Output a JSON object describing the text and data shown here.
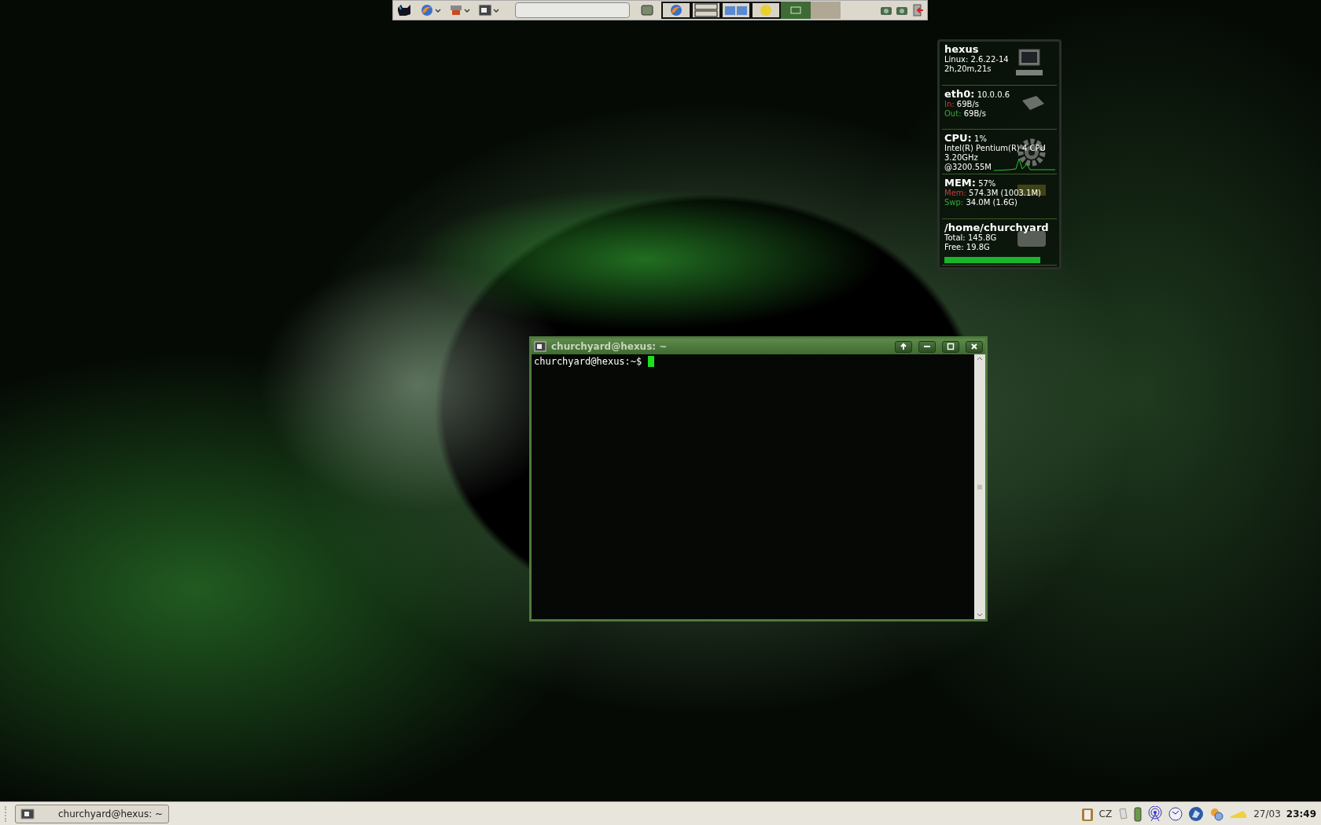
{
  "top_panel": {
    "launchers": [
      {
        "kind": "menu",
        "dropdown": false
      },
      {
        "kind": "browser",
        "dropdown": true
      },
      {
        "kind": "tools",
        "dropdown": true
      },
      {
        "kind": "terminal",
        "dropdown": true
      }
    ],
    "workspaces": [
      {
        "kind": "browser",
        "selected": false
      },
      {
        "kind": "windows",
        "selected": false
      },
      {
        "kind": "folders",
        "selected": false
      },
      {
        "kind": "smiley",
        "selected": false
      },
      {
        "kind": "window",
        "selected": true
      },
      {
        "kind": "empty",
        "selected": false
      }
    ]
  },
  "conky": {
    "sections": [
      {
        "kind": "host",
        "title": "hexus",
        "lines": [
          "Linux: 2.6.22-14",
          "2h,20m,21s"
        ]
      },
      {
        "kind": "net",
        "title": "eth0:",
        "value": "10.0.0.6",
        "rows": [
          {
            "label": "In:",
            "value": "69B/s",
            "color": "#c83a3a"
          },
          {
            "label": "Out:",
            "value": "69B/s",
            "color": "#3aa83a"
          }
        ]
      },
      {
        "kind": "cpu",
        "title": "CPU:",
        "value": "1%",
        "lines": [
          "Intel(R) Pentium(R) 4 CPU",
          "3.20GHz",
          "@3200.55M"
        ]
      },
      {
        "kind": "mem",
        "title": "MEM:",
        "value": "57%",
        "rows": [
          {
            "label": "Mem:",
            "value": "574.3M (1003.1M)",
            "color": "#c83a3a"
          },
          {
            "label": "Swp:",
            "value": "34.0M (1.6G)",
            "color": "#3aa83a"
          }
        ]
      },
      {
        "kind": "disk",
        "title": "/home/churchyard",
        "lines": [
          "Total: 145.8G",
          "Free: 19.8G"
        ],
        "level": 0.87
      }
    ]
  },
  "terminal": {
    "title": "churchyard@hexus: ~",
    "prompt": "churchyard@hexus:~$"
  },
  "taskbar": {
    "tasks": [
      {
        "label": "churchyard@hexus: ~",
        "selected": false
      }
    ],
    "keyboard_layout": "CZ",
    "date": "27/03",
    "time": "23:49"
  }
}
